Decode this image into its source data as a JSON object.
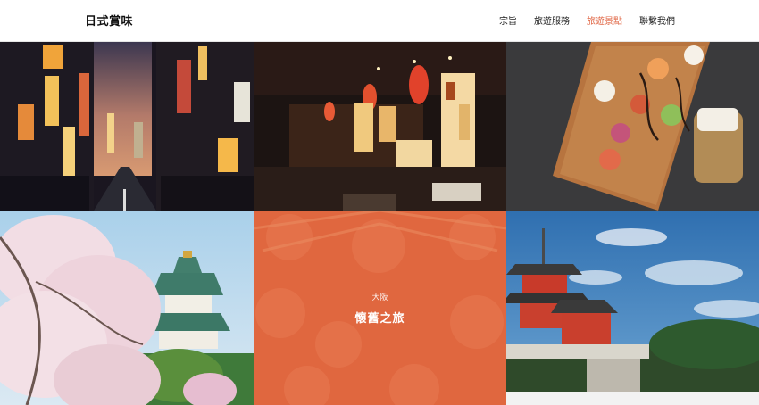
{
  "site": {
    "brand": "日式賞味"
  },
  "nav": {
    "items": [
      {
        "label": "宗旨",
        "active": false
      },
      {
        "label": "旅遊服務",
        "active": false
      },
      {
        "label": "旅遊景點",
        "active": true
      },
      {
        "label": "聯繫我們",
        "active": false
      }
    ]
  },
  "colors": {
    "accent": "#e06644",
    "overlay": "#e0673f"
  },
  "gallery": {
    "featured": {
      "subtitle": "大阪",
      "title": "懷舊之旅"
    }
  }
}
